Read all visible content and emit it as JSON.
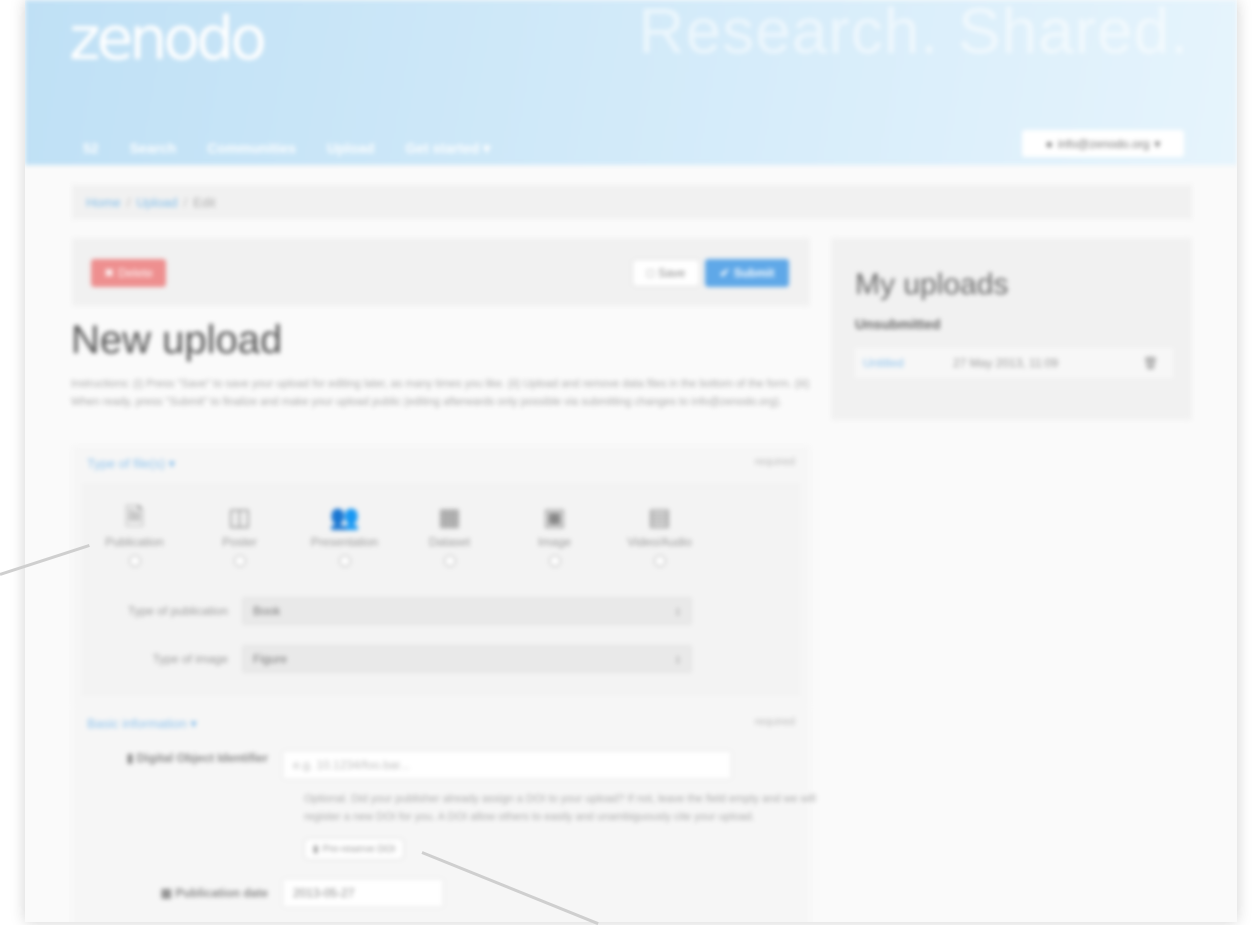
{
  "header": {
    "logo": "zenodo",
    "tagline": "Research. Shared.",
    "nav": [
      "52",
      "Search",
      "Communities",
      "Upload",
      "Get started ▾"
    ],
    "user_email": "info@zenodo.org",
    "user_caret": "▾"
  },
  "breadcrumb": {
    "home": "Home",
    "upload": "Upload",
    "current": "Edit",
    "sep": "/"
  },
  "toolbar": {
    "delete_label": "Delete",
    "save_label": "Save",
    "submit_label": "Submit"
  },
  "main": {
    "title": "New upload",
    "instructions": "Instructions: (i) Press \"Save\" to save your upload for editing later, as many times you like. (ii) Upload and remove data files in the bottom of the form. (iii) When ready, press \"Submit\" to finalize and make your upload public (editing afterwards only possible via submitting changes to info@zenodo.org)."
  },
  "type_section": {
    "heading": "Type of file(s) ▾",
    "required": "required",
    "types": [
      {
        "label": "Publication",
        "icon": "publication-icon",
        "glyph": "🗎"
      },
      {
        "label": "Poster",
        "icon": "poster-icon",
        "glyph": "◫"
      },
      {
        "label": "Presentation",
        "icon": "presentation-icon",
        "glyph": "👥"
      },
      {
        "label": "Dataset",
        "icon": "dataset-icon",
        "glyph": "▦"
      },
      {
        "label": "Image",
        "icon": "image-icon",
        "glyph": "▣"
      },
      {
        "label": "Video/Audio",
        "icon": "video-icon",
        "glyph": "▤"
      }
    ],
    "pub_type_label": "Type of publication",
    "pub_type_value": "Book",
    "img_type_label": "Type of image",
    "img_type_value": "Figure",
    "caret": "↕"
  },
  "basic_section": {
    "heading": "Basic information ▾",
    "required": "required",
    "doi_label": "Digital Object Identifier",
    "doi_placeholder": "e.g. 10.1234/foo.bar...",
    "doi_help": "Optional. Did your publisher already assign a DOI to your upload? If not, leave the field empty and we will register a new DOI for you. A DOI allow others to easily and unambiguously cite your upload.",
    "doi_button": "Pre-reserve DOI",
    "date_label": "Publication date",
    "date_value": "2013-05-27"
  },
  "sidebar": {
    "title": "My uploads",
    "subtitle": "Unsubmitted",
    "row_name": "Untitled",
    "row_date": "27 May 2013, 11:09",
    "trash": "🗑"
  },
  "colors": {
    "accent": "#5fa8e8",
    "delete": "#ee8f8f",
    "header_start": "#bfe0f5",
    "header_end": "#e6f4fc"
  }
}
